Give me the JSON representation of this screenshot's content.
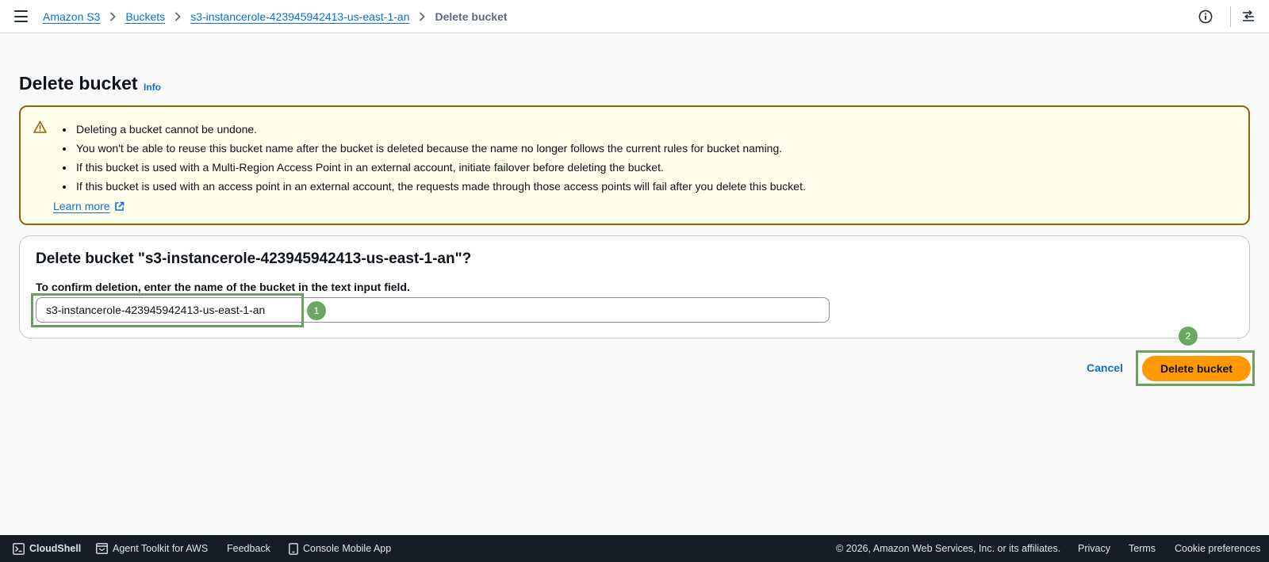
{
  "breadcrumb": {
    "items": [
      {
        "label": "Amazon S3"
      },
      {
        "label": "Buckets"
      },
      {
        "label": "s3-instancerole-423945942413-us-east-1-an"
      }
    ],
    "current": "Delete bucket"
  },
  "page": {
    "title": "Delete bucket",
    "info_link": "Info"
  },
  "alert": {
    "type": "warning",
    "icon": "warning-icon",
    "items": [
      "Deleting a bucket cannot be undone.",
      "You won't be able to reuse this bucket name after the bucket is deleted because the name no longer follows the current rules for bucket naming.",
      "If this bucket is used with a Multi-Region Access Point in an external account, initiate failover before deleting the bucket.",
      "If this bucket is used with an access point in an external account, the requests made through those access points will fail after you delete this bucket."
    ],
    "learn_more": "Learn more"
  },
  "confirm": {
    "title": "Delete bucket \"s3-instancerole-423945942413-us-east-1-an\"?",
    "label": "To confirm deletion, enter the name of the bucket in the text input field.",
    "input_value": "s3-instancerole-423945942413-us-east-1-an"
  },
  "actions": {
    "cancel_label": "Cancel",
    "delete_label": "Delete bucket"
  },
  "annotations": {
    "badge_1": "1",
    "badge_2": "2"
  },
  "footer": {
    "cloudshell": "CloudShell",
    "agent_toolkit": "Agent Toolkit for AWS",
    "feedback": "Feedback",
    "mobile_app": "Console Mobile App",
    "copyright": "© 2026, Amazon Web Services, Inc. or its affiliates.",
    "privacy": "Privacy",
    "terms": "Terms",
    "cookies": "Cookie preferences"
  },
  "colors": {
    "link": "#0972d3",
    "primary_button": "#ff9900",
    "warning_border": "#8d6605",
    "warning_bg": "#fffce9",
    "annotation_green": "#67a35d",
    "footer_bg": "#161d26"
  }
}
